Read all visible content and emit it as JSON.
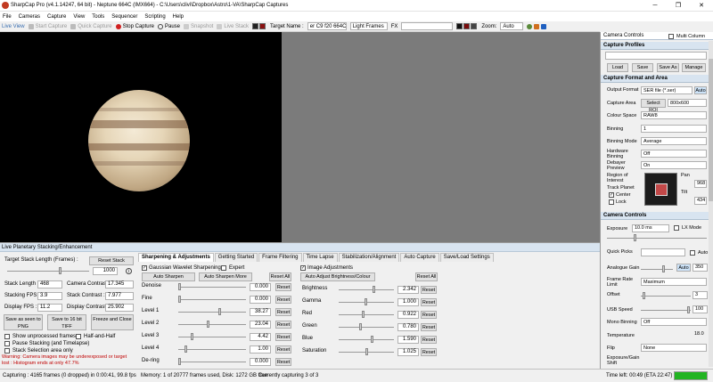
{
  "title": "SharpCap Pro (v4.1.14247, 64 bit) - Neptune 664C (IMX664) - C:\\Users\\clivi\\Dropbox\\Astro\\1-VA\\SharpCap Captures",
  "menu": [
    "File",
    "Cameras",
    "Capture",
    "View",
    "Tools",
    "Sequencer",
    "Scripting",
    "Help"
  ],
  "toolbar": {
    "live_view": "Live View",
    "start_capture": "Start Capture",
    "quick_capture": "Quick Capture",
    "stop_capture": "Stop Capture",
    "pause": "Pause",
    "snapshot": "Snapshot",
    "live_stack": "Live Stack",
    "target_name_label": "Target Name :",
    "target_name_value": "er C9 f20 664C",
    "frame_type": "Light Frames",
    "fx_label": "FX",
    "zoom_label": "Zoom:",
    "zoom_value": "Auto"
  },
  "lower": {
    "header": "Live Planetary Stacking/Enhancement",
    "target_length_label": "Target Stack Length (Frames) :",
    "reset_stack": "Reset Stack",
    "target_length_value": "1000",
    "stack_length_label": "Stack Length :",
    "stack_length": "468",
    "cam_contrast_label": "Camera Contrast :",
    "cam_contrast": "17.345",
    "stacking_fps_label": "Stacking FPS :",
    "stacking_fps": "3.9",
    "stack_contrast_label": "Stack Contrast :",
    "stack_contrast": "7.977",
    "display_fps_label": "Display FPS :",
    "display_fps": "11.2",
    "display_contrast_label": "Display Contrast :",
    "display_contrast": "25.902",
    "save_png": "Save as seen to PNG",
    "save_tiff": "Save to 16 bit TIFF",
    "freeze": "Freeze and Close",
    "show_unprocessed": "Show unprocessed frames",
    "half_and_half": "Half-and-Half",
    "pause_stacking": "Pause Stacking (and Timelapse)",
    "stack_selection": "Stack Selection area only",
    "warning": "Warning: Camera images may be underexposed or target lost : Histogram ends at only 47.7%",
    "tabs": [
      "Sharpening & Adjustments",
      "Getting Started",
      "Frame Filtering",
      "Time Lapse",
      "Stabilization/Alignment",
      "Auto Capture",
      "Save/Load Settings"
    ],
    "gw_sharpening": "Gaussian Wavelet Sharpening",
    "expert": "Expert",
    "auto_sharpen": "Auto Sharpen",
    "auto_sharpen_more": "Auto Sharpen More",
    "reset_all": "Reset All",
    "reset": "Reset",
    "sharpen_rows": [
      {
        "label": "Denoise",
        "value": "0.000",
        "level": 0.0
      },
      {
        "label": "Fine",
        "value": "0.000",
        "level": 0.0
      },
      {
        "label": "Level 1",
        "value": "38.27",
        "level": 0.62
      },
      {
        "label": "Level 2",
        "value": "23.04",
        "level": 0.44
      },
      {
        "label": "Level 3",
        "value": "4.42",
        "level": 0.2
      },
      {
        "label": "Level 4",
        "value": "1.00",
        "level": 0.1
      },
      {
        "label": "De-ring",
        "value": "0.000",
        "level": 0.0
      }
    ],
    "image_adjustments": "Image Adjustments",
    "auto_adjust": "Auto Adjust Brightness/Colour",
    "adjust_rows": [
      {
        "label": "Brightness",
        "value": "2.342",
        "level": 0.66
      },
      {
        "label": "Gamma",
        "value": "1.000",
        "level": 0.5
      },
      {
        "label": "Red",
        "value": "0.922",
        "level": 0.45
      },
      {
        "label": "Green",
        "value": "0.780",
        "level": 0.4
      },
      {
        "label": "Blue",
        "value": "1.590",
        "level": 0.62
      },
      {
        "label": "Saturation",
        "value": "1.025",
        "level": 0.51
      }
    ]
  },
  "right": {
    "header": "Camera Controls",
    "multi_column": "Multi Column",
    "profiles_header": "Capture Profiles",
    "load": "Load",
    "save": "Save",
    "save_as": "Save As",
    "manage": "Manage",
    "format_header": "Capture Format and Area",
    "rows": [
      {
        "label": "Output Format",
        "value": "SER file (*.ser)",
        "extra": "Auto"
      },
      {
        "label": "Capture Area",
        "value": "800x600",
        "extra": "Select ROI"
      },
      {
        "label": "Colour Space",
        "value": "RAW8"
      },
      {
        "label": "Binning",
        "value": "1"
      },
      {
        "label": "Binning Mode",
        "value": "Average"
      },
      {
        "label": "Hardware Binning",
        "value": "Off"
      },
      {
        "label": "Debayer Preview",
        "value": "On"
      }
    ],
    "roi_label": "Region of Interest",
    "pan": "Pan",
    "pan_value": "968",
    "track_planet": "Track Planet",
    "center": "Center",
    "tilt": "Tilt",
    "tilt_value": "434",
    "lock": "Lock",
    "cam_header": "Camera Controls",
    "exposure_label": "Exposure",
    "exposure": "10.0 ms",
    "lx_mode": "LX Mode",
    "quick_picks": "Quick Picks",
    "auto": "Auto",
    "cam_rows": [
      {
        "label": "Analogue Gain",
        "value": "350"
      },
      {
        "label": "Frame Rate Limit",
        "value": "Maximum"
      },
      {
        "label": "Offset",
        "value": "3"
      },
      {
        "label": "USB Speed",
        "value": "100"
      },
      {
        "label": "Mono Binning",
        "value": "Off"
      },
      {
        "label": "Temperature",
        "value": "18.0"
      },
      {
        "label": "Flip",
        "value": "None"
      },
      {
        "label": "Exposure/Gain Shift",
        "value": ""
      }
    ]
  },
  "status": {
    "capturing": "Capturing : 4165 frames (0 dropped) in 0:00:41, 99.8 fps",
    "memory": "Memory: 1 of 20777 frames used, Disk: 1272 GB free",
    "currently": "Currently capturing 3 of 3",
    "time_left": "Time left: 00:49 (ETA 22:47)"
  },
  "colors": {
    "accent": "#0078d7",
    "warning": "#c00000",
    "status_green": "#22b422"
  }
}
